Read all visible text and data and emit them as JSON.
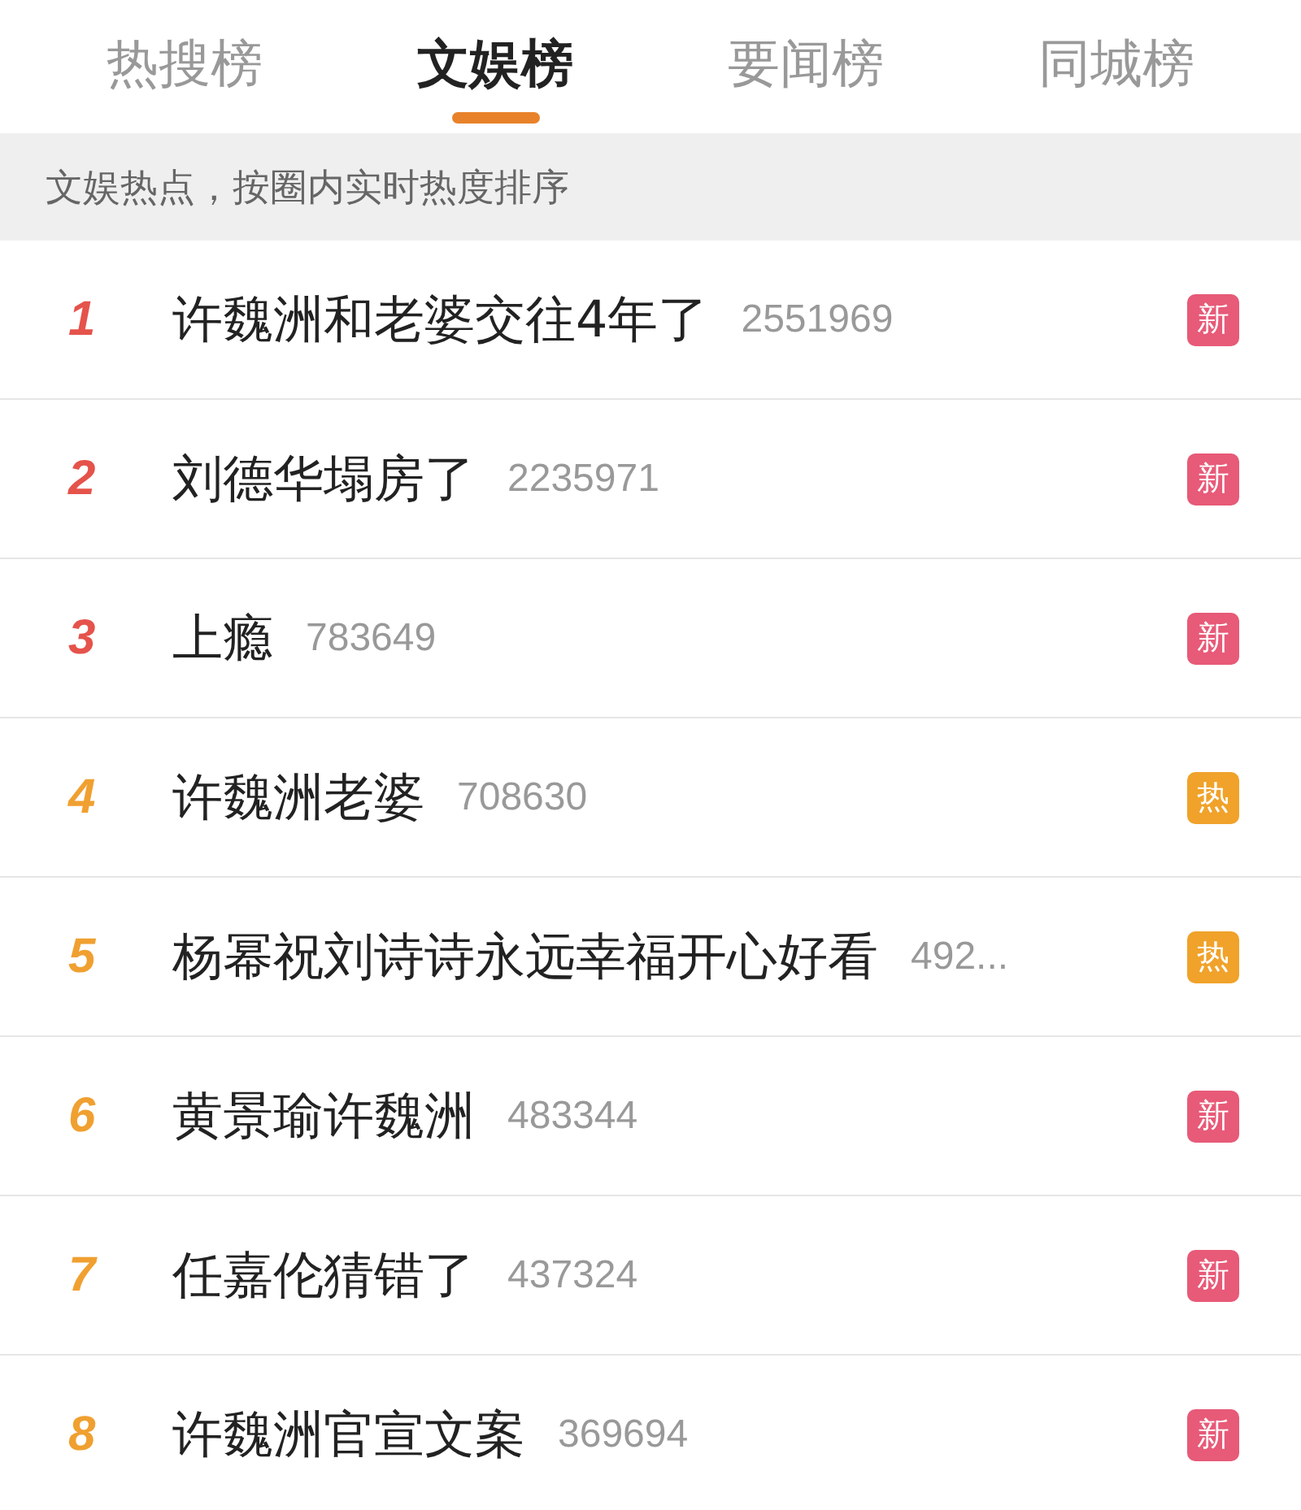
{
  "tabs": [
    {
      "label": "热搜榜",
      "selected": false
    },
    {
      "label": "文娱榜",
      "selected": true
    },
    {
      "label": "要闻榜",
      "selected": false
    },
    {
      "label": "同城榜",
      "selected": false
    }
  ],
  "subtitle": "文娱热点，按圈内实时热度排序",
  "rows": [
    {
      "rank": "1",
      "color": "#e5534b",
      "title": "许魏洲和老婆交往4年了",
      "count": "2551969",
      "badge": {
        "kind": "new",
        "text": "新"
      }
    },
    {
      "rank": "2",
      "color": "#e5534b",
      "title": "刘德华塌房了",
      "count": "2235971",
      "badge": {
        "kind": "new",
        "text": "新"
      }
    },
    {
      "rank": "3",
      "color": "#e5534b",
      "title": "上瘾",
      "count": "783649",
      "badge": {
        "kind": "new",
        "text": "新"
      }
    },
    {
      "rank": "4",
      "color": "#f0a030",
      "title": "许魏洲老婆",
      "count": "708630",
      "badge": {
        "kind": "hot",
        "text": "热"
      }
    },
    {
      "rank": "5",
      "color": "#f0a030",
      "title": "杨幂祝刘诗诗永远幸福开心好看",
      "count": "492...",
      "badge": {
        "kind": "hot",
        "text": "热"
      }
    },
    {
      "rank": "6",
      "color": "#f0a030",
      "title": "黄景瑜许魏洲",
      "count": "483344",
      "badge": {
        "kind": "new",
        "text": "新"
      }
    },
    {
      "rank": "7",
      "color": "#f0a030",
      "title": "任嘉伦猜错了",
      "count": "437324",
      "badge": {
        "kind": "new",
        "text": "新"
      }
    },
    {
      "rank": "8",
      "color": "#f0a030",
      "title": "许魏洲官宣文案",
      "count": "369694",
      "badge": {
        "kind": "new",
        "text": "新"
      }
    }
  ]
}
